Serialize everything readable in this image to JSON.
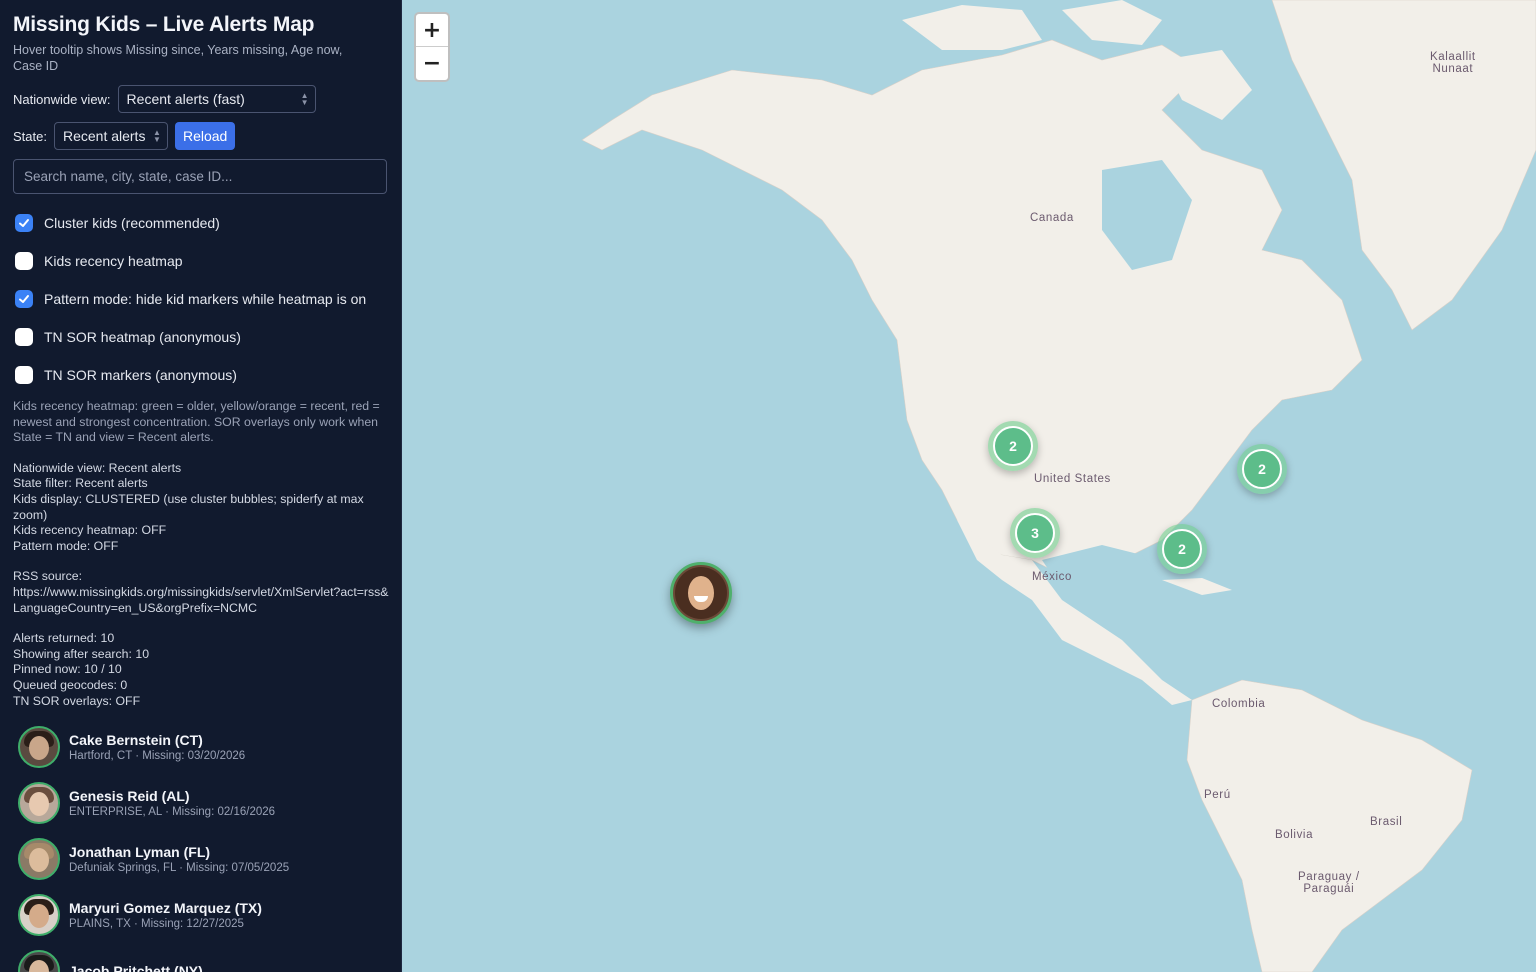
{
  "sidebar": {
    "title": "Missing Kids – Live Alerts Map",
    "subtitle": "Hover tooltip shows Missing since, Years missing, Age now, Case ID",
    "nationwide_label": "Nationwide view:",
    "nationwide_value": "Recent alerts (fast)",
    "state_label": "State:",
    "state_value": "Recent alerts",
    "reload_label": "Reload",
    "search_placeholder": "Search name, city, state, case ID...",
    "checkboxes": [
      {
        "label": "Cluster kids (recommended)",
        "checked": true
      },
      {
        "label": "Kids recency heatmap",
        "checked": false
      },
      {
        "label": "Pattern mode: hide kid markers while heatmap is on",
        "checked": true
      },
      {
        "label": "TN SOR heatmap (anonymous)",
        "checked": false
      },
      {
        "label": "TN SOR markers (anonymous)",
        "checked": false
      }
    ],
    "note": "Kids recency heatmap: green = older, yellow/orange = recent, red = newest and strongest concentration. SOR overlays only work when State = TN and view = Recent alerts.",
    "status_lines": [
      "Nationwide view: Recent alerts",
      "State filter: Recent alerts",
      "Kids display: CLUSTERED (use cluster bubbles; spiderfy at max zoom)",
      "Kids recency heatmap: OFF",
      "Pattern mode: OFF"
    ],
    "rss_label": "RSS source:",
    "rss_url": "https://www.missingkids.org/missingkids/servlet/XmlServlet?act=rss&LanguageCountry=en_US&orgPrefix=NCMC",
    "counts": [
      "Alerts returned: 10",
      "Showing after search: 10",
      "Pinned now: 10 / 10",
      "Queued geocodes: 0",
      "TN SOR overlays: OFF"
    ],
    "kids": [
      {
        "name": "Cake Bernstein (CT)",
        "meta": "Hartford, CT · Missing: 03/20/2026"
      },
      {
        "name": "Genesis Reid (AL)",
        "meta": "ENTERPRISE, AL · Missing: 02/16/2026"
      },
      {
        "name": "Jonathan Lyman (FL)",
        "meta": "Defuniak Springs, FL · Missing: 07/05/2025"
      },
      {
        "name": "Maryuri Gomez Marquez (TX)",
        "meta": "PLAINS, TX · Missing: 12/27/2025"
      },
      {
        "name": "Jacob Pritchett (NY)",
        "meta": ""
      }
    ]
  },
  "map": {
    "zoom_in": "+",
    "zoom_out": "−",
    "labels": {
      "greenland": "Kalaallit\nNunaat",
      "canada": "Canada",
      "us": "United States",
      "mexico": "México",
      "colombia": "Colombia",
      "peru": "Perú",
      "bolivia": "Bolivia",
      "brasil": "Brasil",
      "paraguay": "Paraguay /\nParaguái"
    },
    "clusters": {
      "west": "2",
      "east": "2",
      "mexico": "3",
      "florida": "2"
    },
    "colors": {
      "water": "#aad3df",
      "land": "#f2efe9",
      "cluster": "#5dbd8a"
    }
  }
}
